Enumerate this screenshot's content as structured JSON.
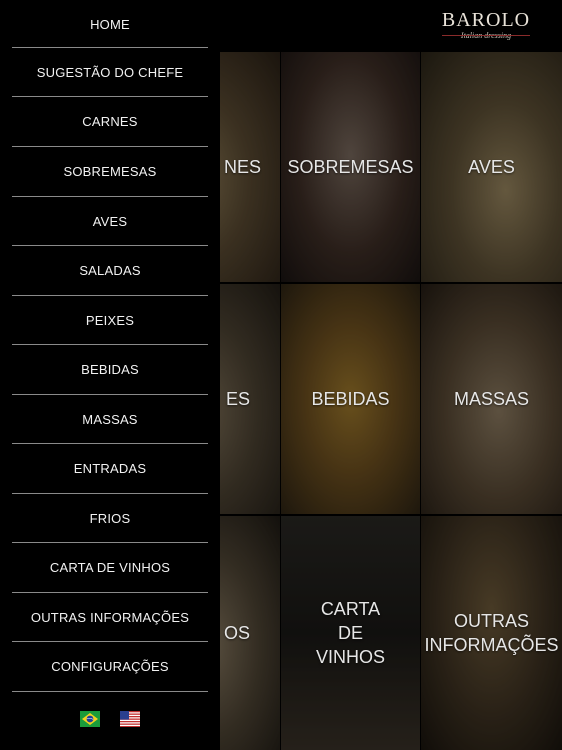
{
  "header": {
    "logo_main": "BAROLO",
    "logo_sub": "Italian dressing"
  },
  "menu": {
    "items": [
      {
        "label": "HOME"
      },
      {
        "label": "SUGESTÃO DO CHEFE"
      },
      {
        "label": "CARNES"
      },
      {
        "label": "SOBREMESAS"
      },
      {
        "label": "AVES"
      },
      {
        "label": "SALADAS"
      },
      {
        "label": "PEIXES"
      },
      {
        "label": "BEBIDAS"
      },
      {
        "label": "MASSAS"
      },
      {
        "label": "ENTRADAS"
      },
      {
        "label": "FRIOS"
      },
      {
        "label": "CARTA DE VINHOS"
      },
      {
        "label": "OUTRAS INFORMAÇÕES"
      },
      {
        "label": "CONFIGURAÇÕES"
      }
    ],
    "languages": [
      "brazil-flag-icon",
      "usa-flag-icon"
    ]
  },
  "grid": {
    "tiles": [
      {
        "label": "NES"
      },
      {
        "label": "SOBREMESAS"
      },
      {
        "label": "AVES"
      },
      {
        "label": "ES"
      },
      {
        "label": "BEBIDAS"
      },
      {
        "label": "MASSAS"
      },
      {
        "label": "OS"
      },
      {
        "label": "CARTA\nDE\nVINHOS"
      },
      {
        "label": "OUTRAS\nINFORMAÇÕES"
      }
    ]
  },
  "colors": {
    "menu_bg": "#000000",
    "separator": "#8a8a8a",
    "logo_accent": "#8a2b2b"
  }
}
